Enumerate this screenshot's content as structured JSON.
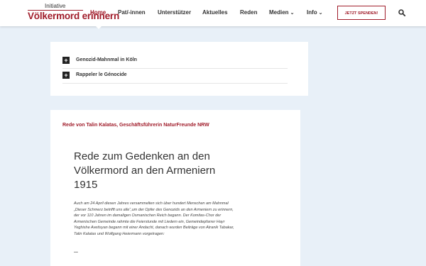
{
  "logo": {
    "top": "Initiative",
    "main": "Völkermord erinnern"
  },
  "nav": {
    "items": [
      {
        "label": "Home",
        "active": true
      },
      {
        "label": "Pat/-innen"
      },
      {
        "label": "Unterstützer"
      },
      {
        "label": "Aktuelles"
      },
      {
        "label": "Reden"
      },
      {
        "label": "Medien",
        "dropdown": true
      },
      {
        "label": "Info",
        "dropdown": true
      }
    ],
    "donate_label": "JETZT SPENDEN!",
    "search_icon": "search-icon"
  },
  "accordion": {
    "items": [
      {
        "label": "Genozid-Mahnmal in Köln"
      },
      {
        "label": "Rappeler le Génocide"
      }
    ]
  },
  "speech": {
    "speaker": "Rede von Talin Kalatas, Geschäftsführerin NaturFreunde NRW",
    "title": "Rede zum Gedenken an den Völkermord an den Armeniern 1915",
    "body": "Auch am 24 April diesen Jahres versammelten sich über hundert Menschen am Mahnmal „Dieser Schmerz betrifft uns alle“,um der Opfer des Genozids an den Armeniern zu erinnern, der vor 110 Jahren im damaligen Osmanischen Reich begann. Der Komitas-Chor der Armenischen Gemeinde rahmte die Feierstunde mit Liedern ein, Gemeindepfarrer Hayr Yeghishe Avetisyan begann mit einer Andacht, danach wurden Beiträge von Atranik Tabakar, Talin Kalatas und Wolfgang Heiermann vorgetragen:",
    "more": "..."
  },
  "colors": {
    "brand": "#a01c2a",
    "background": "#e8f0f8"
  }
}
